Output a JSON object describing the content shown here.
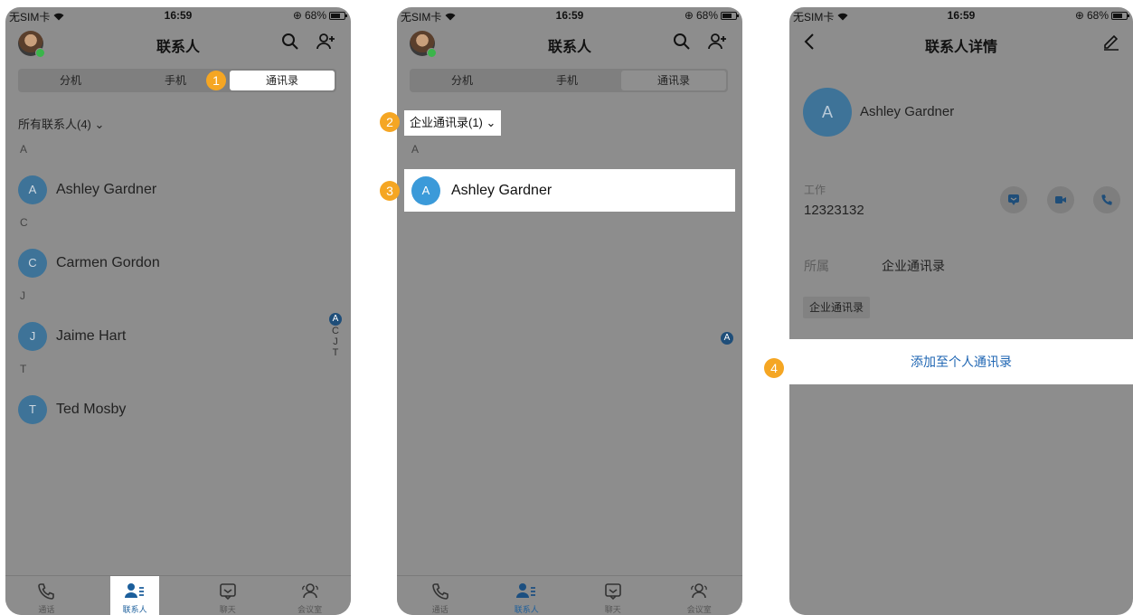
{
  "status": {
    "carrier": "无SIM卡",
    "time": "16:59",
    "battery": "68%"
  },
  "screen1": {
    "title": "联系人",
    "segments": [
      "分机",
      "手机",
      "通讯录"
    ],
    "active_segment": 2,
    "filter": "所有联系人(4)",
    "groups": [
      {
        "letter": "A",
        "contacts": [
          {
            "initial": "A",
            "name": "Ashley Gardner"
          }
        ]
      },
      {
        "letter": "C",
        "contacts": [
          {
            "initial": "C",
            "name": "Carmen Gordon"
          }
        ]
      },
      {
        "letter": "J",
        "contacts": [
          {
            "initial": "J",
            "name": "Jaime Hart"
          }
        ]
      },
      {
        "letter": "T",
        "contacts": [
          {
            "initial": "T",
            "name": "Ted Mosby"
          }
        ]
      }
    ],
    "index": [
      "A",
      "C",
      "J",
      "T"
    ]
  },
  "screen2": {
    "title": "联系人",
    "segments": [
      "分机",
      "手机",
      "通讯录"
    ],
    "filter": "企业通讯录(1)",
    "letter": "A",
    "contact": {
      "initial": "A",
      "name": "Ashley Gardner"
    },
    "index": [
      "A"
    ]
  },
  "screen3": {
    "title": "联系人详情",
    "contact": {
      "initial": "A",
      "name": "Ashley Gardner"
    },
    "work_label": "工作",
    "work_number": "12323132",
    "belongs_label": "所属",
    "belongs_value": "企业通讯录",
    "chip": "企业通讯录",
    "add_button": "添加至个人通讯录"
  },
  "tabbar": [
    "通话",
    "联系人",
    "聊天",
    "会议室"
  ],
  "badges": [
    "1",
    "2",
    "3",
    "4"
  ],
  "colors": {
    "accent_blue": "#1f66b3",
    "avatar_blue": "#3e7398",
    "highlight_avatar": "#3b9ad9",
    "badge_orange": "#f5a623",
    "online_green": "#3ab54a"
  }
}
